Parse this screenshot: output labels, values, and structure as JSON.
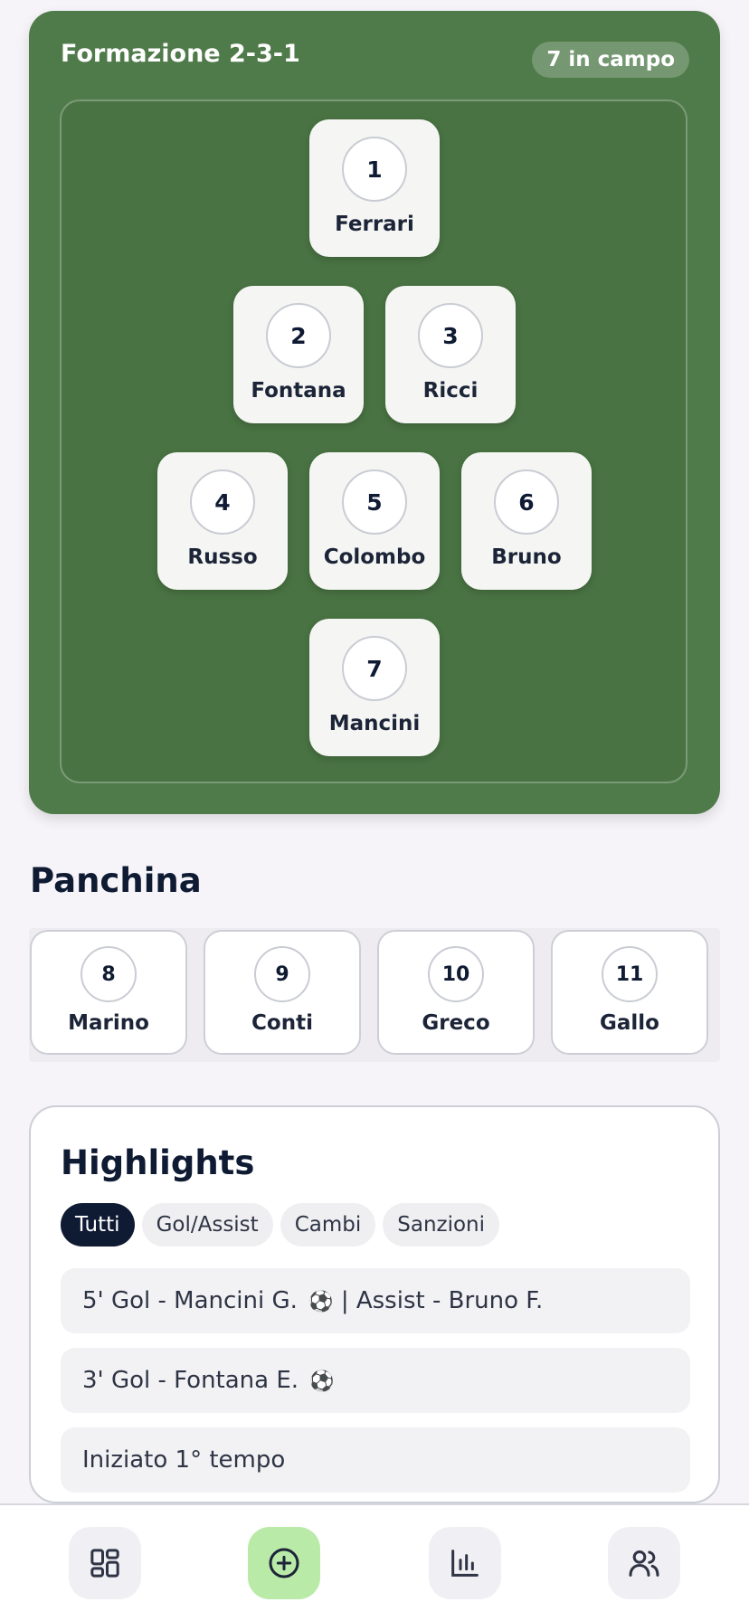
{
  "formation": {
    "title": "Formazione 2-3-1",
    "badge": "7 in campo",
    "players": [
      {
        "number": "1",
        "name": "Ferrari"
      },
      {
        "number": "2",
        "name": "Fontana"
      },
      {
        "number": "3",
        "name": "Ricci"
      },
      {
        "number": "4",
        "name": "Russo"
      },
      {
        "number": "5",
        "name": "Colombo"
      },
      {
        "number": "6",
        "name": "Bruno"
      },
      {
        "number": "7",
        "name": "Mancini"
      }
    ]
  },
  "bench": {
    "title": "Panchina",
    "players": [
      {
        "number": "8",
        "name": "Marino"
      },
      {
        "number": "9",
        "name": "Conti"
      },
      {
        "number": "10",
        "name": "Greco"
      },
      {
        "number": "11",
        "name": "Gallo"
      }
    ]
  },
  "highlights": {
    "title": "Highlights",
    "filters": [
      "Tutti",
      "Gol/Assist",
      "Cambi",
      "Sanzioni"
    ],
    "active_filter": "Tutti",
    "events": [
      {
        "text": "5' Gol - Mancini G.",
        "icon": "⚽",
        "extra": " | Assist - Bruno F."
      },
      {
        "text": "3' Gol - Fontana E.",
        "icon": "⚽",
        "extra": ""
      },
      {
        "text": "Iniziato 1° tempo",
        "icon": "",
        "extra": ""
      }
    ]
  },
  "nav": {
    "items": [
      {
        "icon": "dashboard-icon"
      },
      {
        "icon": "add-circle-icon",
        "active": true
      },
      {
        "icon": "stats-chart-icon"
      },
      {
        "icon": "people-icon"
      }
    ],
    "active_color": "#b9eaa8"
  },
  "colors": {
    "pitch": "#4f7a49",
    "navy": "#0f1a33"
  }
}
